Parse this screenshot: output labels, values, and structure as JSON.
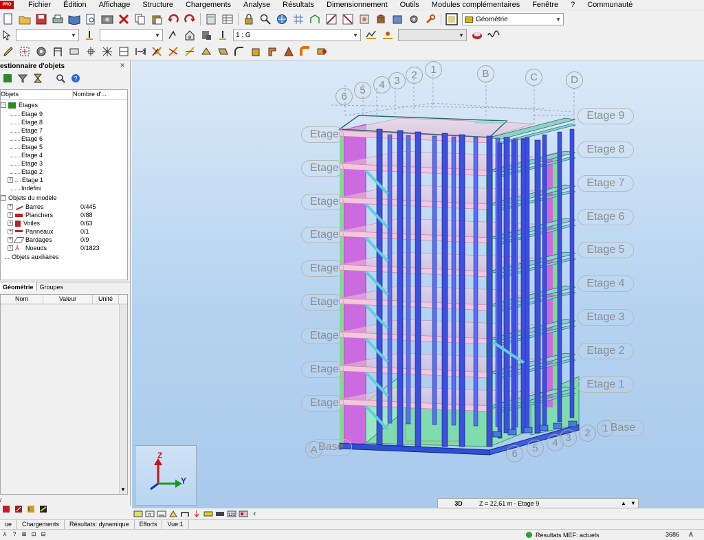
{
  "menu": {
    "logo": "PRO",
    "items": [
      "Fichier",
      "Édition",
      "Affichage",
      "Structure",
      "Chargements",
      "Analyse",
      "Résultats",
      "Dimensionnement",
      "Outils",
      "Modules complémentaires",
      "Fenêtre",
      "?",
      "Communauté"
    ]
  },
  "toolbar1": {
    "layout_combo": "Géométrie"
  },
  "toolbar2": {
    "combo1": "",
    "combo2": "",
    "case_combo": "1 : G",
    "combo4": ""
  },
  "object_manager": {
    "title": "estionnaire d'objets",
    "col_objects": "Objets",
    "col_count": "Nombre d'...",
    "tree": {
      "etages_label": "Étages",
      "etages": [
        "Etage 9",
        "Etage 8",
        "Etage 7",
        "Etage 6",
        "Etage 5",
        "Etage 4",
        "Etage 3",
        "Etage 2",
        "Etage 1",
        "Indéfini"
      ],
      "model_objects_label": "Objets du modèle",
      "model_objects": [
        {
          "label": "Barres",
          "value": "0/445"
        },
        {
          "label": "Planchers",
          "value": "0/88"
        },
        {
          "label": "Voiles",
          "value": "0/63"
        },
        {
          "label": "Panneaux",
          "value": "0/1"
        },
        {
          "label": "Bardages",
          "value": "0/9"
        },
        {
          "label": "Noeuds",
          "value": "0/1823"
        }
      ],
      "aux_label": "Objets auxiliaires"
    },
    "tabs": [
      "Géométrie",
      "Groupes"
    ],
    "props_headers": [
      "Nom",
      "Valeur",
      "Unité"
    ]
  },
  "viewport": {
    "level_labels": [
      "Etage 9",
      "Etage 8",
      "Etage 7",
      "Etage 6",
      "Etage 5",
      "Etage 4",
      "Etage 3",
      "Etage 2",
      "Etage 1",
      "Base"
    ],
    "left_level_label": "Etage",
    "left_base_label": "Base",
    "grid_numbers": [
      "6",
      "5",
      "4",
      "3",
      "2",
      "1"
    ],
    "grid_letters": [
      "B",
      "C",
      "D"
    ],
    "base_grid_numbers": [
      "6",
      "5",
      "4",
      "3",
      "2",
      "1"
    ],
    "base_letter": "A",
    "axis": {
      "z": "Z",
      "y": "Y"
    }
  },
  "z_info": {
    "mode": "3D",
    "text": "Z = 22,61 m - Etage 9"
  },
  "bottom_tabs": [
    "ue",
    "Chargements",
    "Résultats: dynamique",
    "Efforts",
    "Vue:1"
  ],
  "status": {
    "mef": "Résultats MEF: actuels",
    "nodes": "3686",
    "end": "A"
  },
  "colors": {
    "pink_floor": "#f3c8de",
    "magenta_wall": "#cc6be0",
    "green_column": "#7fdc8e",
    "blue_column": "#3d4fe0",
    "teal_beam": "#8fd0c8",
    "viewport_top": "#dbe9f7",
    "viewport_bottom": "#a9caec"
  }
}
